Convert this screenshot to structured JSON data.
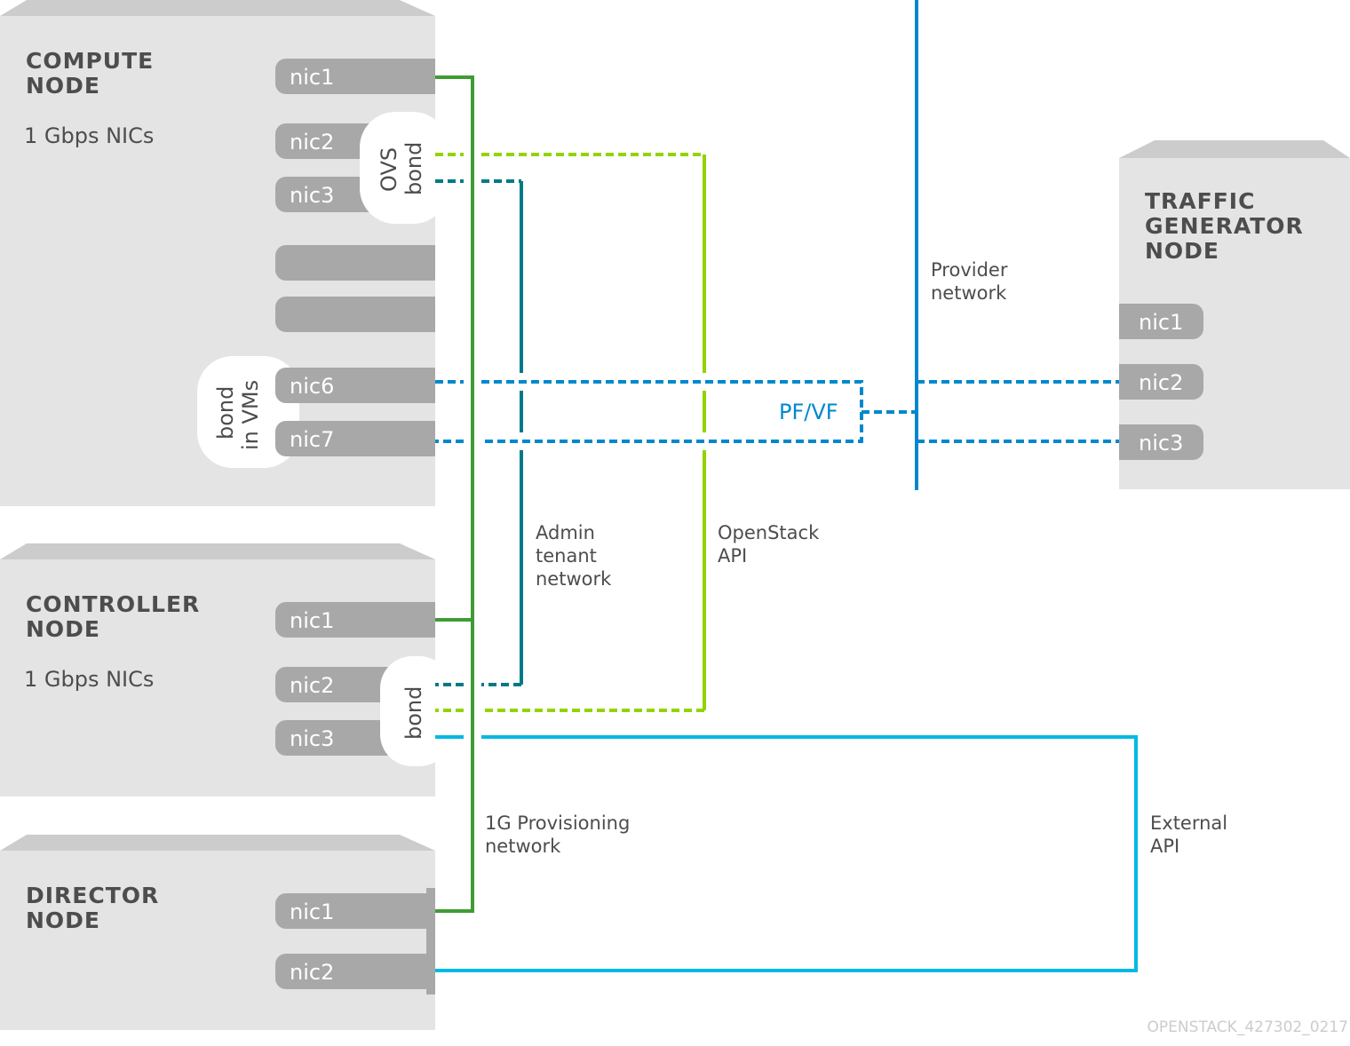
{
  "nodes": {
    "compute": {
      "title_line1": "COMPUTE",
      "title_line2": "NODE",
      "subtitle": "1 Gbps NICs",
      "nics": [
        "nic1",
        "nic2",
        "nic3",
        "nic6",
        "nic7"
      ],
      "ovs_bond_line1": "OVS",
      "ovs_bond_line2": "bond",
      "vm_bond_line1": "bond",
      "vm_bond_line2": "in VMs"
    },
    "controller": {
      "title_line1": "CONTROLLER",
      "title_line2": "NODE",
      "subtitle": "1 Gbps NICs",
      "nics": [
        "nic1",
        "nic2",
        "nic3"
      ],
      "bond": "bond"
    },
    "director": {
      "title_line1": "DIRECTOR",
      "title_line2": "NODE",
      "nics": [
        "nic1",
        "nic2"
      ]
    },
    "traffic": {
      "title_line1": "TRAFFIC",
      "title_line2": "GENERATOR",
      "title_line3": "NODE",
      "nics": [
        "nic1",
        "nic2",
        "nic3"
      ]
    }
  },
  "networks": {
    "provider": {
      "line1": "Provider",
      "line2": "network",
      "color": "#0088ce"
    },
    "admin": {
      "line1": "Admin",
      "line2": "tenant",
      "line3": "network",
      "color": "#007a87"
    },
    "openstack": {
      "line1": "OpenStack",
      "line2": "API",
      "color": "#92d400"
    },
    "provisioning": {
      "line1": "1G Provisioning",
      "line2": "network",
      "color": "#3f9c35"
    },
    "external": {
      "line1": "External",
      "line2": "API",
      "color": "#00b9e4"
    },
    "pfvf": "PF/VF"
  },
  "watermark": "OPENSTACK_427302_0217"
}
